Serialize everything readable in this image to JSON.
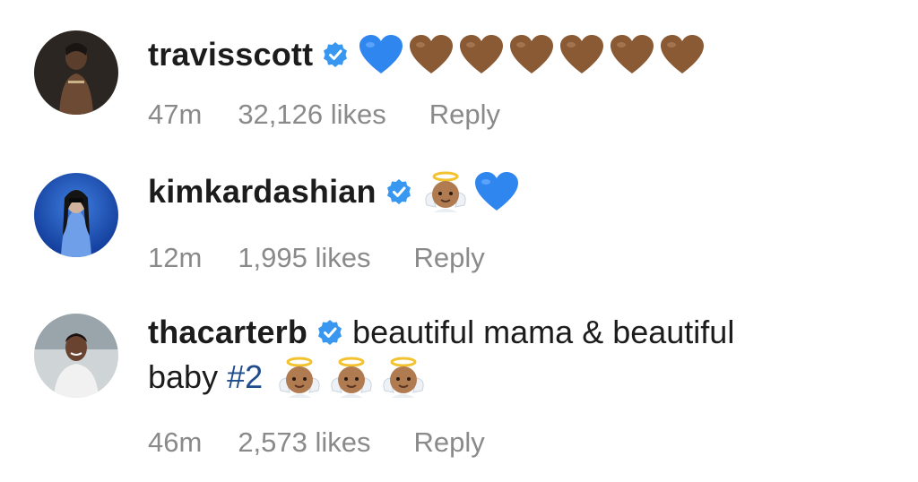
{
  "comments": [
    {
      "username": "travisscott",
      "text": "",
      "emojis": [
        "blue-heart",
        "brown-heart",
        "brown-heart",
        "brown-heart",
        "brown-heart",
        "brown-heart",
        "brown-heart"
      ],
      "time": "47m",
      "likes": "32,126 likes",
      "reply": "Reply"
    },
    {
      "username": "kimkardashian",
      "text": "",
      "emojis": [
        "baby-angel",
        "blue-heart"
      ],
      "time": "12m",
      "likes": "1,995 likes",
      "reply": "Reply"
    },
    {
      "username": "thacarterb",
      "text": "beautiful mama & beautiful",
      "text_line2": "baby",
      "hashtag": "#2",
      "emojis": [
        "baby-angel",
        "baby-angel",
        "baby-angel"
      ],
      "time": "46m",
      "likes": "2,573 likes",
      "reply": "Reply"
    }
  ],
  "colors": {
    "verified_badge": "#3897f0",
    "blue_heart": "#2f86ef",
    "brown_heart": "#8a5a35",
    "meta_text": "#8a8a8a",
    "hashtag": "#1f4c8c"
  }
}
